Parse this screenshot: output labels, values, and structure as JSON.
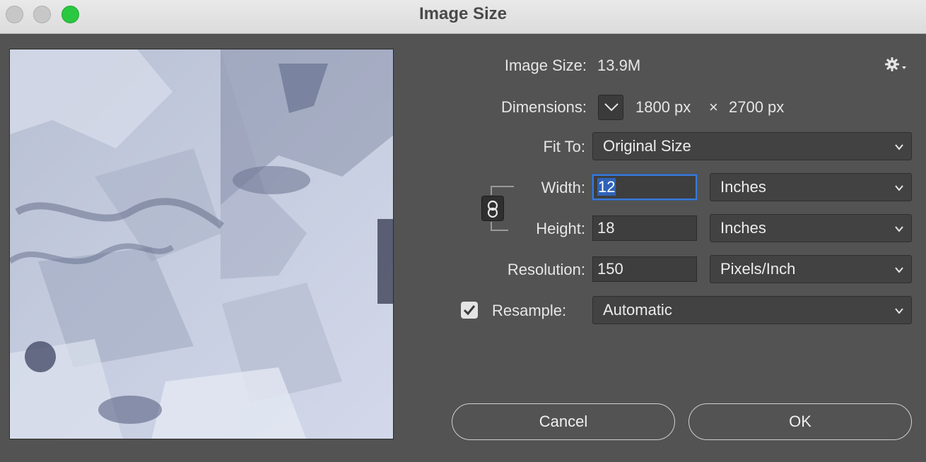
{
  "window": {
    "title": "Image Size"
  },
  "image_size": {
    "label": "Image Size:",
    "value": "13.9M"
  },
  "dimensions": {
    "label": "Dimensions:",
    "width": "1800 px",
    "times": "×",
    "height": "2700 px"
  },
  "fit_to": {
    "label": "Fit To:",
    "value": "Original Size"
  },
  "width": {
    "label": "Width:",
    "value": "12",
    "unit": "Inches"
  },
  "height": {
    "label": "Height:",
    "value": "18",
    "unit": "Inches"
  },
  "resolution": {
    "label": "Resolution:",
    "value": "150",
    "unit": "Pixels/Inch"
  },
  "resample": {
    "label": "Resample:",
    "checked": true,
    "value": "Automatic"
  },
  "buttons": {
    "cancel": "Cancel",
    "ok": "OK"
  },
  "icons": {
    "settings": "gear-icon",
    "dimensions_toggle": "chevron-down-icon",
    "constrain": "link-icon",
    "resample_check": "checkmark-icon"
  },
  "colors": {
    "focus": "#3a7ad6",
    "traffic_max": "#2ac840",
    "background": "#535353"
  }
}
